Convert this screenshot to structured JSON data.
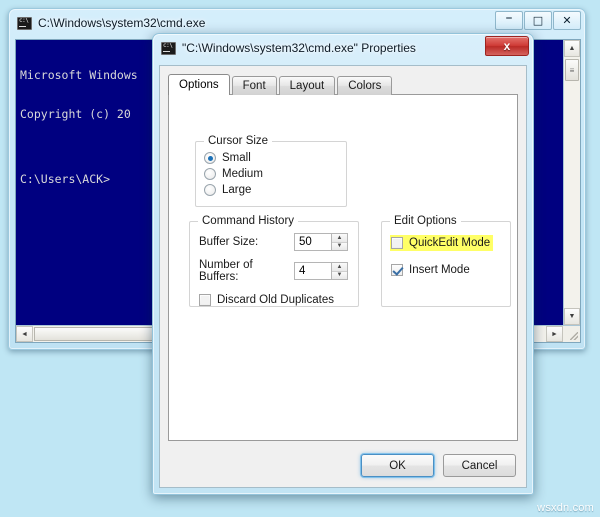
{
  "cmd_window": {
    "title": "C:\\Windows\\system32\\cmd.exe",
    "icon": "cmd-icon",
    "controls": {
      "minimize": "–",
      "maximize": "□",
      "close": "✕"
    },
    "console_lines": [
      "Microsoft Windows",
      "Copyright (c) 20",
      "",
      "C:\\Users\\ACK>"
    ],
    "scrollbar": {
      "up_arrow": "▲",
      "down_arrow": "▼",
      "left_arrow": "◄",
      "right_arrow": "►",
      "thumb_glyph": "≡"
    }
  },
  "properties_dialog": {
    "title": "\"C:\\Windows\\system32\\cmd.exe\" Properties",
    "close_label": "x",
    "tabs": [
      {
        "label": "Options",
        "active": true
      },
      {
        "label": "Font",
        "active": false
      },
      {
        "label": "Layout",
        "active": false
      },
      {
        "label": "Colors",
        "active": false
      }
    ],
    "cursor_size": {
      "legend": "Cursor Size",
      "options": [
        {
          "label": "Small",
          "checked": true
        },
        {
          "label": "Medium",
          "checked": false
        },
        {
          "label": "Large",
          "checked": false
        }
      ]
    },
    "command_history": {
      "legend": "Command History",
      "buffer_size_label": "Buffer Size:",
      "buffer_size_value": "50",
      "number_of_buffers_label": "Number of Buffers:",
      "number_of_buffers_value": "4",
      "discard_old_duplicates_label": "Discard Old Duplicates",
      "discard_old_duplicates_checked": false
    },
    "edit_options": {
      "legend": "Edit Options",
      "quickedit_label": "QuickEdit Mode",
      "quickedit_checked": false,
      "quickedit_highlighted": true,
      "insert_label": "Insert Mode",
      "insert_checked": true
    },
    "buttons": {
      "ok": "OK",
      "cancel": "Cancel"
    }
  },
  "watermark": {
    "text": "wsxdn.com"
  },
  "colors": {
    "console_background": "#000080",
    "highlight": "#ffff66",
    "accent_blue": "#1b71b8",
    "close_red": "#cf3b36",
    "aero_glass": "#c9e8f7"
  }
}
